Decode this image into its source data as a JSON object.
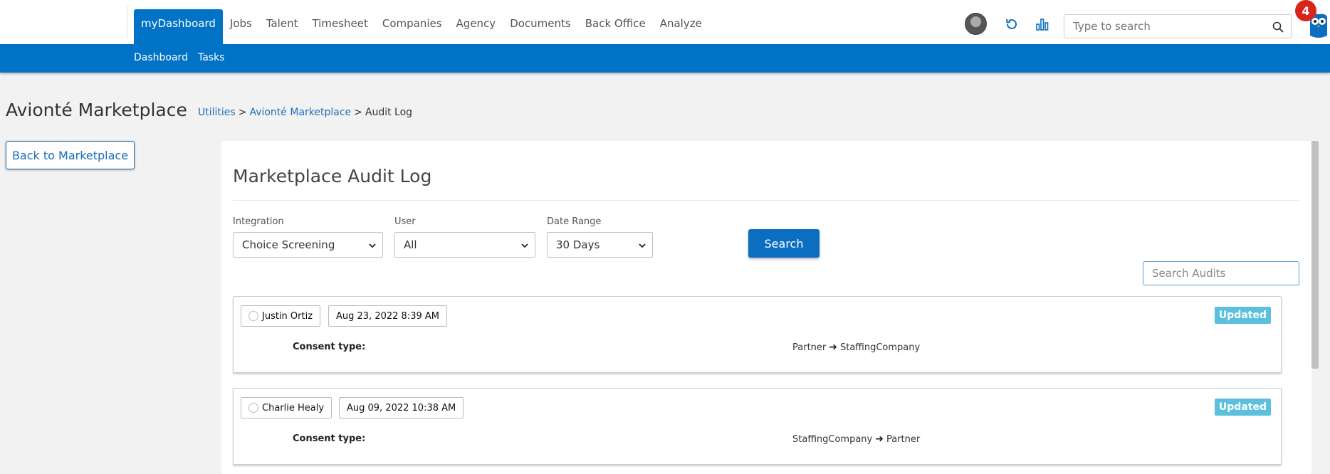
{
  "nav": {
    "items": [
      {
        "label": "myDashboard",
        "active": true
      },
      {
        "label": "Jobs"
      },
      {
        "label": "Talent"
      },
      {
        "label": "Timesheet"
      },
      {
        "label": "Companies"
      },
      {
        "label": "Agency"
      },
      {
        "label": "Documents"
      },
      {
        "label": "Back Office"
      },
      {
        "label": "Analyze"
      }
    ],
    "search_placeholder": "Type to search",
    "notification_count": "4",
    "accent_color": "#0073c6"
  },
  "subnav": {
    "items": [
      {
        "label": "Dashboard"
      },
      {
        "label": "Tasks"
      }
    ]
  },
  "page": {
    "title": "Avionté Marketplace",
    "breadcrumb": [
      "Utilities",
      "Avionté Marketplace",
      "Audit Log"
    ],
    "back_button": "Back to Marketplace"
  },
  "panel": {
    "title": "Marketplace Audit Log",
    "filters": {
      "integration": {
        "label": "Integration",
        "value": "Choice Screening"
      },
      "user": {
        "label": "User",
        "value": "All"
      },
      "date_range": {
        "label": "Date Range",
        "value": "30 Days"
      }
    },
    "search_button": "Search",
    "audit_search_placeholder": "Search Audits"
  },
  "audits": [
    {
      "user": "Justin Ortiz",
      "timestamp": "Aug 23, 2022 8:39 AM",
      "status": "Updated",
      "field": "Consent type:",
      "from": "Partner",
      "to": "StaffingCompany"
    },
    {
      "user": "Charlie Healy",
      "timestamp": "Aug 09, 2022 10:38 AM",
      "status": "Updated",
      "field": "Consent type:",
      "from": "StaffingCompany",
      "to": "Partner"
    }
  ]
}
